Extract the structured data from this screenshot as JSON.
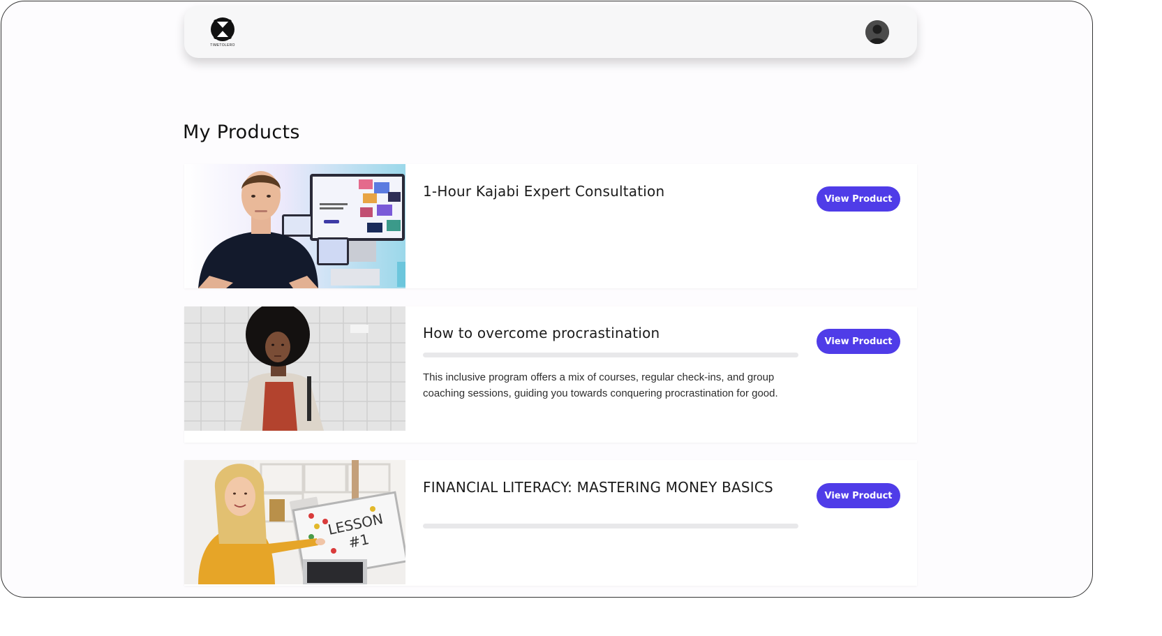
{
  "header": {
    "logo_text": "TIMETOLERO",
    "logo_icon": "hourglass-x-logo",
    "avatar_icon": "user-avatar"
  },
  "main": {
    "title": "My Products"
  },
  "products": [
    {
      "title": "1-Hour Kajabi Expert Consultation",
      "button_label": "View Product",
      "image_alt": "Man in front of computer screens showing website templates",
      "description": "",
      "progress": null
    },
    {
      "title": "How to overcome procrastination",
      "button_label": "View Product",
      "image_alt": "Woman with curly hair standing in front of a white tiled wall",
      "description": "This inclusive program offers a mix of courses, regular check-ins, and group coaching sessions, guiding you towards conquering procrastination for good.",
      "progress": 0
    },
    {
      "title": "FINANCIAL LITERACY: MASTERING MONEY BASICS",
      "button_label": "View Product",
      "image_alt": "Woman pointing at whiteboard reading LESSON #1",
      "description": "",
      "progress": 0
    }
  ],
  "colors": {
    "accent": "#4f3ce8",
    "progress_track": "#e8e8ea",
    "page_bg": "#fdfcfe"
  }
}
